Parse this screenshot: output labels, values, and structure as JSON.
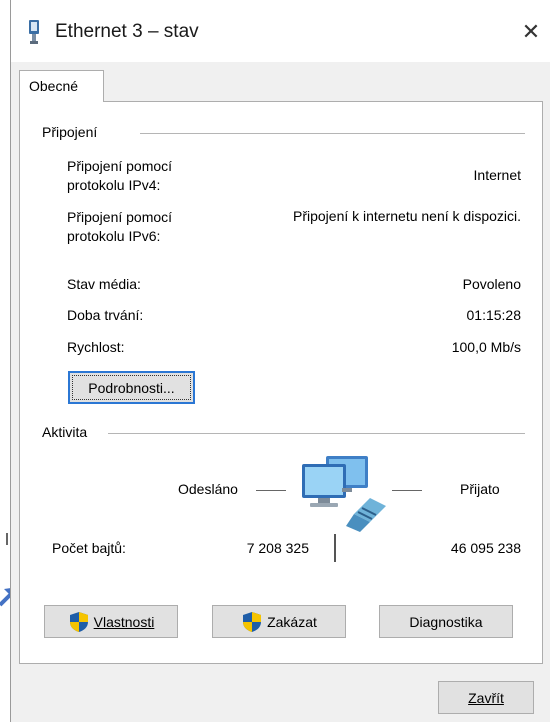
{
  "window": {
    "title": "Ethernet 3 – stav",
    "close_label": "✕"
  },
  "tabs": [
    {
      "label": "Obecné"
    }
  ],
  "connection": {
    "section_label": "Připojení",
    "ipv4_label": "Připojení pomocí\nprotokolu IPv4:",
    "ipv4_value": "Internet",
    "ipv6_label": "Připojení pomocí\nprotokolu IPv6:",
    "ipv6_value": "Připojení k internetu není k dispozici.",
    "media_label": "Stav média:",
    "media_value": "Povoleno",
    "duration_label": "Doba trvání:",
    "duration_value": "01:15:28",
    "speed_label": "Rychlost:",
    "speed_value": "100,0 Mb/s",
    "details_button": "Podrobnosti..."
  },
  "activity": {
    "section_label": "Aktivita",
    "sent_label": "Odesláno",
    "received_label": "Přijato",
    "bytes_label": "Počet bajtů:",
    "bytes_sent": "7 208 325",
    "bytes_received": "46 095 238"
  },
  "buttons": {
    "properties": "Vlastnosti",
    "disable": "Zakázat",
    "diagnose": "Diagnostika",
    "close": "Zavřít"
  },
  "icons": {
    "title": "ethernet-adapter-icon",
    "activity": "network-computers-icon",
    "shield": "uac-shield-icon"
  },
  "colors": {
    "accent": "#2b77d4",
    "annotation_arrow": "#4472c4"
  }
}
